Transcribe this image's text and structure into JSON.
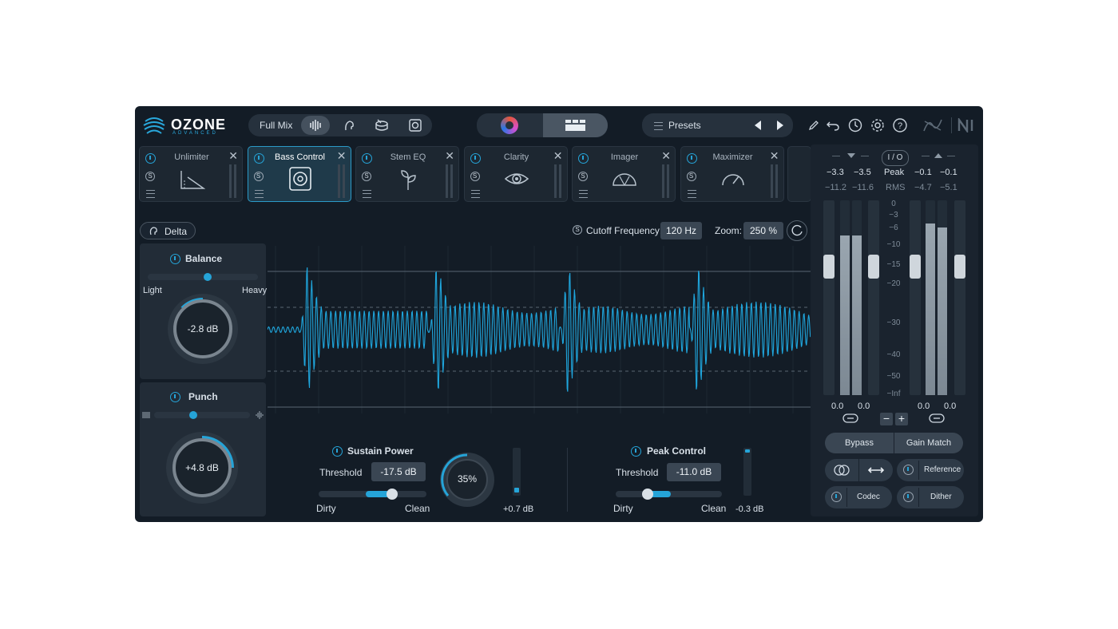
{
  "brand": {
    "name": "OZONE",
    "edition": "ADVANCED"
  },
  "header": {
    "mode_label": "Full Mix",
    "mode_icons": [
      "waveform-icon",
      "vocal-icon",
      "drum-icon",
      "speaker-icon"
    ],
    "presets_label": "Presets",
    "toolbar_icons": [
      "pencil-icon",
      "undo-icon",
      "history-icon",
      "gear-icon",
      "help-icon",
      "signal-icon",
      "ni-logo"
    ]
  },
  "modules": [
    {
      "title": "Unlimiter",
      "icon": "slope-icon",
      "active": false
    },
    {
      "title": "Bass Control",
      "icon": "subwoofer-icon",
      "active": true
    },
    {
      "title": "Stem EQ",
      "icon": "sprout-icon",
      "active": false
    },
    {
      "title": "Clarity",
      "icon": "eye-icon",
      "active": false
    },
    {
      "title": "Imager",
      "icon": "imager-icon",
      "active": false
    },
    {
      "title": "Maximizer",
      "icon": "speedometer-icon",
      "active": false
    }
  ],
  "delta_label": "Delta",
  "balance": {
    "title": "Balance",
    "left": "Light",
    "right": "Heavy",
    "value": "-2.8 dB",
    "slider": 0.55
  },
  "punch": {
    "title": "Punch",
    "value": "+4.8 dB",
    "slider": 0.4
  },
  "display": {
    "cutoff_label": "Cutoff Frequency:",
    "cutoff_value": "120 Hz",
    "zoom_label": "Zoom:",
    "zoom_value": "250 %"
  },
  "sustain": {
    "title": "Sustain Power",
    "threshold_label": "Threshold",
    "threshold_value": "-17.5 dB",
    "left": "Dirty",
    "right": "Clean",
    "knob": "35%",
    "gain": "+0.7 dB",
    "slider": 0.7
  },
  "peak": {
    "title": "Peak Control",
    "threshold_label": "Threshold",
    "threshold_value": "-11.0 dB",
    "left": "Dirty",
    "right": "Clean",
    "gain": "-0.3 dB",
    "slider": 0.28
  },
  "io": {
    "label": "I / O",
    "peak_label": "Peak",
    "rms_label": "RMS",
    "in_peak": [
      "−3.3",
      "−3.5"
    ],
    "in_rms": [
      "−11.2",
      "−11.6"
    ],
    "out_peak": [
      "−0.1",
      "−0.1"
    ],
    "out_rms": [
      "−4.7",
      "−5.1"
    ],
    "scale": [
      "0",
      "−3",
      "−6",
      "−10",
      "−15",
      "−20",
      "−30",
      "−40",
      "−50",
      "−Inf"
    ],
    "in_gain": [
      "0.0",
      "0.0"
    ],
    "out_gain": [
      "0.0",
      "0.0"
    ],
    "in_levels": [
      0.82,
      0.82
    ],
    "out_levels": [
      0.88,
      0.86
    ]
  },
  "footer": {
    "bypass": "Bypass",
    "gain_match": "Gain Match",
    "reference": "Reference",
    "codec": "Codec",
    "dither": "Dither"
  }
}
